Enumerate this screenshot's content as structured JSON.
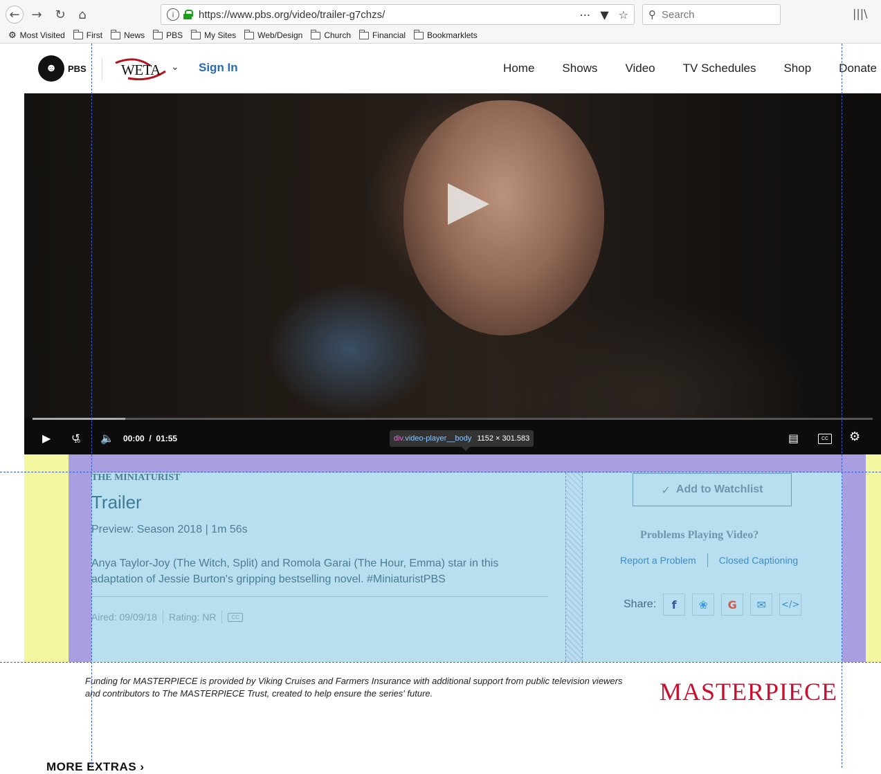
{
  "browser": {
    "url": "https://www.pbs.org/video/trailer-g7chzs/",
    "search_placeholder": "Search",
    "toolbar_icons": [
      "more-icon",
      "pocket-icon",
      "star-icon",
      "library-icon"
    ],
    "bookmarks": [
      "Most Visited",
      "First",
      "News",
      "PBS",
      "My Sites",
      "Web/Design",
      "Church",
      "Financial",
      "Bookmarklets"
    ]
  },
  "header": {
    "pbs_logo": "PBS",
    "station": "WETA",
    "sign_in": "Sign In",
    "nav": [
      "Home",
      "Shows",
      "Video",
      "TV Schedules",
      "Shop",
      "Donate"
    ]
  },
  "player": {
    "current_time": "00:00",
    "duration": "01:55",
    "buffered_fraction": 0.11,
    "tooltip_selector": "div",
    "tooltip_class": ".video-player__body",
    "tooltip_size": "1152 × 301.583",
    "cc_label": "CC",
    "skip_label": "10"
  },
  "details": {
    "show_title": "THE MINIATURIST",
    "episode_title": "Trailer",
    "preview": "Preview: Season 2018",
    "runtime": "1m 56s",
    "description": "Anya Taylor-Joy (The Witch, Split) and Romola Garai (The Hour, Emma) star in this adaptation of Jessie Burton's gripping bestselling novel. #MiniaturistPBS",
    "aired": "Aired: 09/09/18",
    "rating": "Rating: NR",
    "cc_badge": "CC"
  },
  "sidebar": {
    "watchlist": "Add to Watchlist",
    "problems_heading": "Problems Playing Video?",
    "report_link": "Report a Problem",
    "captioning_link": "Closed Captioning",
    "share_label": "Share:"
  },
  "funding": {
    "text": "Funding for MASTERPIECE is provided by Viking Cruises and Farmers Insurance with additional support from public television viewers and contributors to The MASTERPIECE Trust, created to help ensure the series' future.",
    "logo": "MASTERPIECE"
  },
  "more_extras": "MORE EXTRAS",
  "colors": {
    "accent_blue": "#2a6ab3",
    "masterpiece_red": "#c8102e",
    "devtools_content": "#b8dff0",
    "devtools_padding": "#a89ee0",
    "devtools_margin": "#f3f7a0"
  }
}
